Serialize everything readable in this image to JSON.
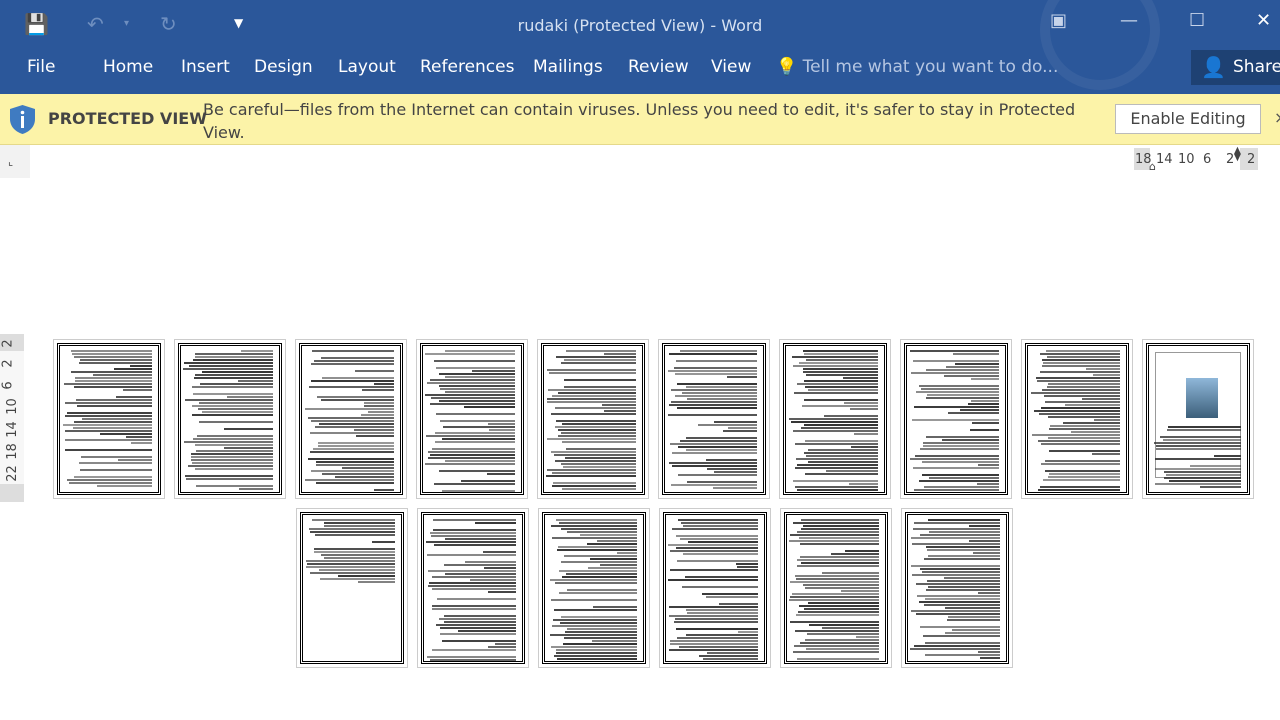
{
  "window": {
    "title": "rudaki (Protected View) - Word"
  },
  "qat": {
    "save_icon": "save-icon",
    "undo_icon": "undo-icon",
    "redo_icon": "redo-icon",
    "customize_icon": "customize-qat-icon"
  },
  "ribbon": {
    "tabs": [
      "File",
      "Home",
      "Insert",
      "Design",
      "Layout",
      "References",
      "Mailings",
      "Review",
      "View"
    ],
    "tell_me": "Tell me what you want to do...",
    "share": "Share"
  },
  "protected_view": {
    "title": "PROTECTED VIEW",
    "message": "Be careful—files from the Internet can contain viruses. Unless you need to edit, it's safer to stay in Protected View.",
    "enable_button": "Enable Editing",
    "close": "×"
  },
  "rulers": {
    "horizontal": [
      "18",
      "14",
      "10",
      "6",
      "2",
      "2"
    ],
    "vertical": [
      "2",
      "2",
      "6",
      "10",
      "14",
      "18",
      "22"
    ]
  },
  "colors": {
    "accent": "#2b579a",
    "banner": "#fcf3a8"
  }
}
